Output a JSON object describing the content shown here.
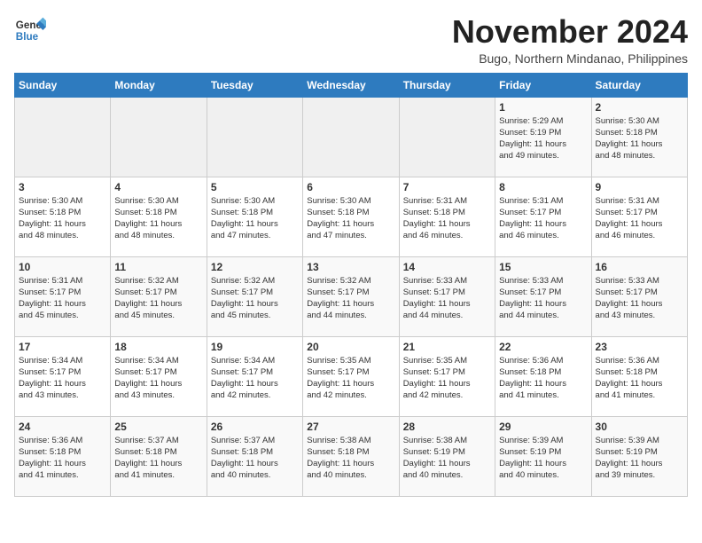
{
  "header": {
    "logo_general": "General",
    "logo_blue": "Blue",
    "month_title": "November 2024",
    "location": "Bugo, Northern Mindanao, Philippines"
  },
  "days_of_week": [
    "Sunday",
    "Monday",
    "Tuesday",
    "Wednesday",
    "Thursday",
    "Friday",
    "Saturday"
  ],
  "weeks": [
    [
      {
        "day": "",
        "info": ""
      },
      {
        "day": "",
        "info": ""
      },
      {
        "day": "",
        "info": ""
      },
      {
        "day": "",
        "info": ""
      },
      {
        "day": "",
        "info": ""
      },
      {
        "day": "1",
        "info": "Sunrise: 5:29 AM\nSunset: 5:19 PM\nDaylight: 11 hours\nand 49 minutes."
      },
      {
        "day": "2",
        "info": "Sunrise: 5:30 AM\nSunset: 5:18 PM\nDaylight: 11 hours\nand 48 minutes."
      }
    ],
    [
      {
        "day": "3",
        "info": "Sunrise: 5:30 AM\nSunset: 5:18 PM\nDaylight: 11 hours\nand 48 minutes."
      },
      {
        "day": "4",
        "info": "Sunrise: 5:30 AM\nSunset: 5:18 PM\nDaylight: 11 hours\nand 48 minutes."
      },
      {
        "day": "5",
        "info": "Sunrise: 5:30 AM\nSunset: 5:18 PM\nDaylight: 11 hours\nand 47 minutes."
      },
      {
        "day": "6",
        "info": "Sunrise: 5:30 AM\nSunset: 5:18 PM\nDaylight: 11 hours\nand 47 minutes."
      },
      {
        "day": "7",
        "info": "Sunrise: 5:31 AM\nSunset: 5:18 PM\nDaylight: 11 hours\nand 46 minutes."
      },
      {
        "day": "8",
        "info": "Sunrise: 5:31 AM\nSunset: 5:17 PM\nDaylight: 11 hours\nand 46 minutes."
      },
      {
        "day": "9",
        "info": "Sunrise: 5:31 AM\nSunset: 5:17 PM\nDaylight: 11 hours\nand 46 minutes."
      }
    ],
    [
      {
        "day": "10",
        "info": "Sunrise: 5:31 AM\nSunset: 5:17 PM\nDaylight: 11 hours\nand 45 minutes."
      },
      {
        "day": "11",
        "info": "Sunrise: 5:32 AM\nSunset: 5:17 PM\nDaylight: 11 hours\nand 45 minutes."
      },
      {
        "day": "12",
        "info": "Sunrise: 5:32 AM\nSunset: 5:17 PM\nDaylight: 11 hours\nand 45 minutes."
      },
      {
        "day": "13",
        "info": "Sunrise: 5:32 AM\nSunset: 5:17 PM\nDaylight: 11 hours\nand 44 minutes."
      },
      {
        "day": "14",
        "info": "Sunrise: 5:33 AM\nSunset: 5:17 PM\nDaylight: 11 hours\nand 44 minutes."
      },
      {
        "day": "15",
        "info": "Sunrise: 5:33 AM\nSunset: 5:17 PM\nDaylight: 11 hours\nand 44 minutes."
      },
      {
        "day": "16",
        "info": "Sunrise: 5:33 AM\nSunset: 5:17 PM\nDaylight: 11 hours\nand 43 minutes."
      }
    ],
    [
      {
        "day": "17",
        "info": "Sunrise: 5:34 AM\nSunset: 5:17 PM\nDaylight: 11 hours\nand 43 minutes."
      },
      {
        "day": "18",
        "info": "Sunrise: 5:34 AM\nSunset: 5:17 PM\nDaylight: 11 hours\nand 43 minutes."
      },
      {
        "day": "19",
        "info": "Sunrise: 5:34 AM\nSunset: 5:17 PM\nDaylight: 11 hours\nand 42 minutes."
      },
      {
        "day": "20",
        "info": "Sunrise: 5:35 AM\nSunset: 5:17 PM\nDaylight: 11 hours\nand 42 minutes."
      },
      {
        "day": "21",
        "info": "Sunrise: 5:35 AM\nSunset: 5:17 PM\nDaylight: 11 hours\nand 42 minutes."
      },
      {
        "day": "22",
        "info": "Sunrise: 5:36 AM\nSunset: 5:18 PM\nDaylight: 11 hours\nand 41 minutes."
      },
      {
        "day": "23",
        "info": "Sunrise: 5:36 AM\nSunset: 5:18 PM\nDaylight: 11 hours\nand 41 minutes."
      }
    ],
    [
      {
        "day": "24",
        "info": "Sunrise: 5:36 AM\nSunset: 5:18 PM\nDaylight: 11 hours\nand 41 minutes."
      },
      {
        "day": "25",
        "info": "Sunrise: 5:37 AM\nSunset: 5:18 PM\nDaylight: 11 hours\nand 41 minutes."
      },
      {
        "day": "26",
        "info": "Sunrise: 5:37 AM\nSunset: 5:18 PM\nDaylight: 11 hours\nand 40 minutes."
      },
      {
        "day": "27",
        "info": "Sunrise: 5:38 AM\nSunset: 5:18 PM\nDaylight: 11 hours\nand 40 minutes."
      },
      {
        "day": "28",
        "info": "Sunrise: 5:38 AM\nSunset: 5:19 PM\nDaylight: 11 hours\nand 40 minutes."
      },
      {
        "day": "29",
        "info": "Sunrise: 5:39 AM\nSunset: 5:19 PM\nDaylight: 11 hours\nand 40 minutes."
      },
      {
        "day": "30",
        "info": "Sunrise: 5:39 AM\nSunset: 5:19 PM\nDaylight: 11 hours\nand 39 minutes."
      }
    ]
  ]
}
